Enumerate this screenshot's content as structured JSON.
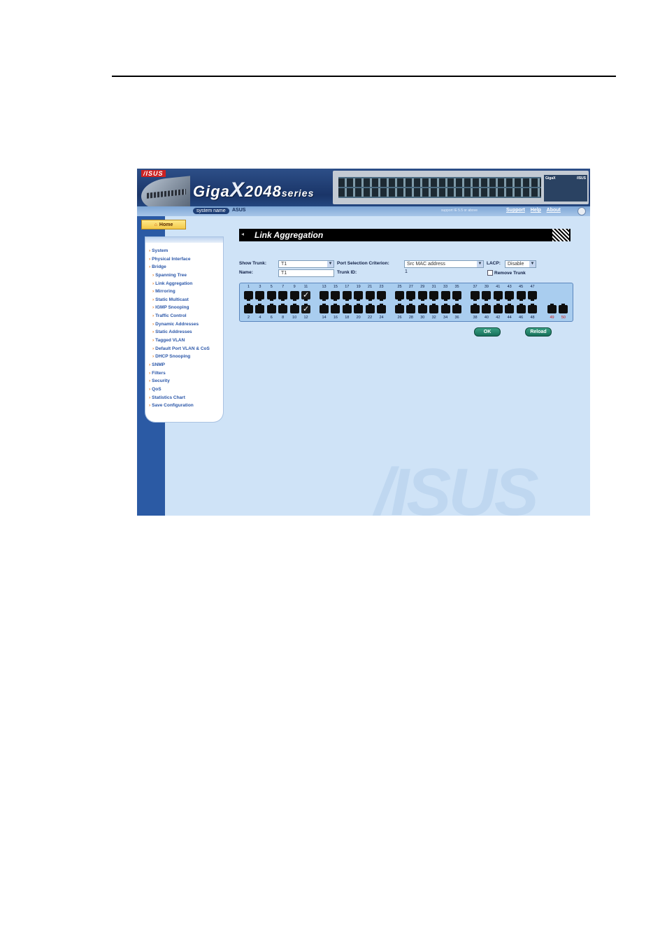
{
  "header": {
    "brand_logo": "/ISUS",
    "product_name": "Giga",
    "product_x": "X",
    "product_model": "2048",
    "product_series": "series",
    "hw_brand": "GigaX",
    "hw_maker": "/ISUS",
    "system_name_label": "system name",
    "system_name_value": "ASUS",
    "support_note": "support IE 5.5 or above",
    "links": [
      "Support",
      "Help",
      "About"
    ]
  },
  "sidebar": {
    "home_label": "Home",
    "menu": [
      {
        "label": "System",
        "level": 1
      },
      {
        "label": "Physical Interface",
        "level": 1
      },
      {
        "label": "Bridge",
        "level": 1
      },
      {
        "label": "Spanning Tree",
        "level": 2
      },
      {
        "label": "Link Aggregation",
        "level": 2
      },
      {
        "label": "Mirroring",
        "level": 2
      },
      {
        "label": "Static Multicast",
        "level": 2
      },
      {
        "label": "IGMP Snooping",
        "level": 2
      },
      {
        "label": "Traffic Control",
        "level": 2
      },
      {
        "label": "Dynamic Addresses",
        "level": 2
      },
      {
        "label": "Static Addresses",
        "level": 2
      },
      {
        "label": "Tagged VLAN",
        "level": 2
      },
      {
        "label": "Default Port VLAN & CoS",
        "level": 2
      },
      {
        "label": "DHCP Snooping",
        "level": 2
      },
      {
        "label": "SNMP",
        "level": 1
      },
      {
        "label": "Filters",
        "level": 1
      },
      {
        "label": "Security",
        "level": 1
      },
      {
        "label": "QoS",
        "level": 1
      },
      {
        "label": "Statistics Chart",
        "level": 1
      },
      {
        "label": "Save Configuration",
        "level": 1
      }
    ]
  },
  "page": {
    "title": "Link Aggregation",
    "show_trunk_label": "Show Trunk:",
    "show_trunk_value": "T1",
    "name_label": "Name:",
    "name_value": "T1",
    "port_selection_label": "Port Selection Criterion:",
    "port_selection_value": "Src MAC address",
    "trunk_id_label": "Trunk ID:",
    "trunk_id_value": "1",
    "lacp_label": "LACP:",
    "lacp_value": "Disable",
    "remove_trunk_label": "Remove Trunk",
    "ok_label": "OK",
    "reload_label": "Reload",
    "watermark": "/ISUS"
  },
  "ports": {
    "top": [
      "1",
      "3",
      "5",
      "7",
      "9",
      "11",
      "13",
      "15",
      "17",
      "19",
      "21",
      "23",
      "25",
      "27",
      "29",
      "31",
      "33",
      "35",
      "37",
      "39",
      "41",
      "43",
      "45",
      "47"
    ],
    "bottom": [
      "2",
      "4",
      "6",
      "8",
      "10",
      "12",
      "14",
      "16",
      "18",
      "20",
      "22",
      "24",
      "26",
      "28",
      "30",
      "32",
      "34",
      "36",
      "38",
      "40",
      "42",
      "44",
      "46",
      "48"
    ],
    "extra": [
      "49",
      "50"
    ],
    "checked": [
      "11",
      "12"
    ]
  }
}
